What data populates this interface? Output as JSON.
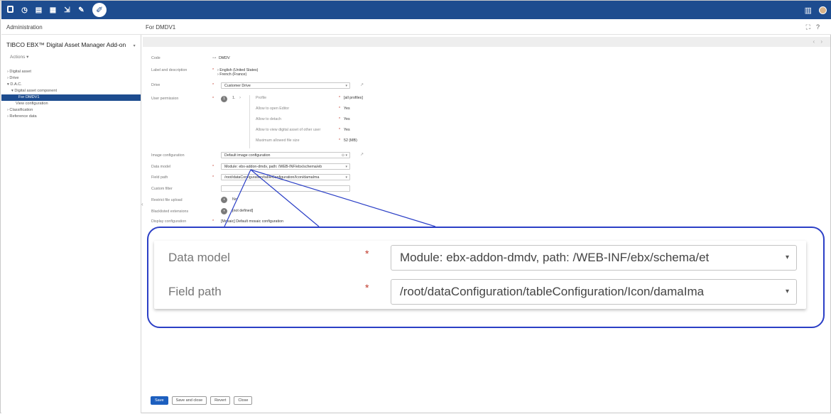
{
  "topbar": {
    "icons": [
      "database-icon",
      "clock-icon",
      "document-icon",
      "data-icon",
      "export-icon",
      "wrench-icon"
    ],
    "active_icon": "wrench-icon",
    "right_icons": [
      "grid-menu-icon",
      "user-avatar-icon"
    ]
  },
  "subheader": {
    "section": "Administration",
    "breadcrumb": "For DMDV1",
    "icons": [
      "expand-icon",
      "help-icon"
    ],
    "help_glyph": "?",
    "expand_glyph": "⛶"
  },
  "sidebar": {
    "module_title": "TIBCO EBX™ Digital Asset Manager Add-on",
    "module_caret": "▾",
    "actions_label": "Actions ▾",
    "items": [
      {
        "label": "› Digital asset",
        "indent": 0,
        "selected": false
      },
      {
        "label": "› Drive",
        "indent": 0,
        "selected": false
      },
      {
        "label": "▾ D.A.C.",
        "indent": 0,
        "selected": false
      },
      {
        "label": "▾ Digital asset component",
        "indent": 1,
        "selected": false
      },
      {
        "label": "For DMDV1",
        "indent": 2,
        "selected": true
      },
      {
        "label": "View configuration",
        "indent": 2,
        "selected": false
      },
      {
        "label": "› Classification",
        "indent": 0,
        "selected": false
      },
      {
        "label": "› Reference data",
        "indent": 0,
        "selected": false
      }
    ]
  },
  "form": {
    "code": {
      "label": "Code",
      "value": "DMDV",
      "icon": "key-icon"
    },
    "label_desc": {
      "label": "Label and description",
      "lines": [
        "English (United States)",
        "French (France)"
      ]
    },
    "drive": {
      "label": "Drive",
      "value": "Customer Drive"
    },
    "user_permission": {
      "label": "User permission",
      "index": "1.",
      "badge": "1",
      "rows": [
        {
          "label": "Profile",
          "value": "[all profiles]"
        },
        {
          "label": "Allow to open Editor",
          "value": "Yes"
        },
        {
          "label": "Allow to detach",
          "value": "Yes"
        },
        {
          "label": "Allow to view digital asset of other user",
          "value": "Yes"
        },
        {
          "label": "Maximum allowed file size",
          "value": "52 (MB)"
        }
      ]
    },
    "image_configuration": {
      "label": "Image configuration",
      "value": "Default image configuration"
    },
    "data_model": {
      "label": "Data model",
      "value": "Module: ebx-addon-dmdv, path: /WEB-INF/ebx/schema/eb"
    },
    "field_path": {
      "label": "Field path",
      "value": "/root/dataConfiguration/tableConfiguration/Icon/damaIma"
    },
    "custom_filter": {
      "label": "Custom filter",
      "value": ""
    },
    "restrict_upload": {
      "label": "Restrict file upload",
      "value": "No"
    },
    "blacklisted": {
      "label": "Blacklisted extensions",
      "value": "[not defined]"
    },
    "display_config": {
      "label": "Display configuration",
      "value": "[Mosaic] Default mosaic configuration"
    }
  },
  "zoom": {
    "data_model_label": "Data model",
    "data_model_value": "Module: ebx-addon-dmdv, path: /WEB-INF/ebx/schema/et",
    "field_path_label": "Field path",
    "field_path_value": "/root/dataConfiguration/tableConfiguration/Icon/damaIma",
    "required_mark": "*",
    "dropdown_glyph": "▾"
  },
  "buttons": {
    "save": "Save",
    "save_close": "Save and close",
    "revert": "Revert",
    "close": "Close"
  },
  "colors": {
    "brand": "#1d4c8f",
    "primary_button": "#1d5fbf",
    "callout": "#2b3fc6",
    "required": "#c0392b"
  }
}
